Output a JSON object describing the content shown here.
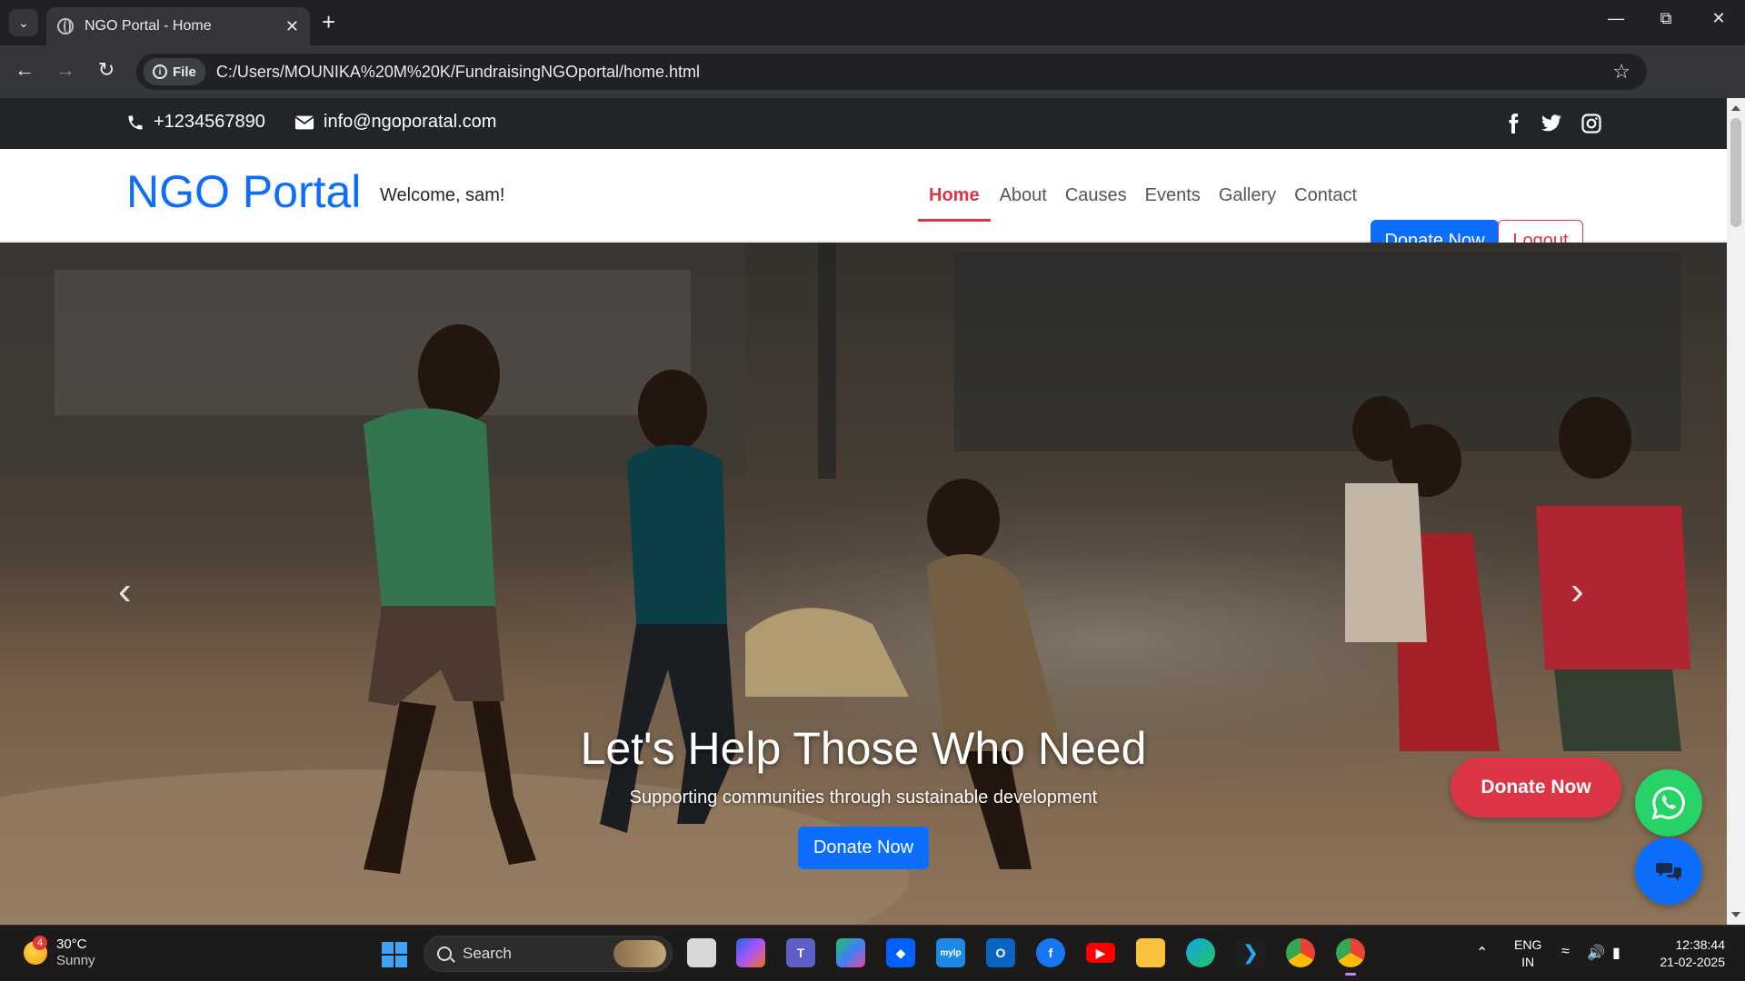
{
  "browser": {
    "tab_title": "NGO Portal - Home",
    "url_chip": "File",
    "url": "C:/Users/MOUNIKA%20M%20K/FundraisingNGOportal/home.html"
  },
  "topbar": {
    "phone": "+1234567890",
    "email": "info@ngoporatal.com"
  },
  "navbar": {
    "brand": "NGO Portal",
    "welcome": "Welcome, sam!",
    "links": [
      "Home",
      "About",
      "Causes",
      "Events",
      "Gallery",
      "Contact"
    ],
    "active_link": "Home",
    "donate_label": "Donate Now",
    "logout_label": "Logout"
  },
  "hero": {
    "title": "Let's Help Those Who Need",
    "subtitle": "Supporting communities through sustainable development",
    "button_label": "Donate Now",
    "slides": 3,
    "active_slide": 1
  },
  "floating": {
    "donate_label": "Donate Now"
  },
  "taskbar": {
    "weather_badge": "4",
    "temperature": "30°C",
    "condition": "Sunny",
    "search_label": "Search",
    "lang_top": "ENG",
    "lang_bottom": "IN",
    "time": "12:38:44",
    "date": "21-02-2025",
    "apps": [
      "file-explorer-window",
      "copilot",
      "teams",
      "m365",
      "dropbox",
      "mylp",
      "outlook",
      "facebook",
      "youtube",
      "folder",
      "edge",
      "vscode",
      "chrome-canary",
      "chrome"
    ]
  },
  "colors": {
    "primary": "#0d6efd",
    "danger": "#dc3545",
    "dark": "#212529",
    "whatsapp": "#25d366"
  }
}
